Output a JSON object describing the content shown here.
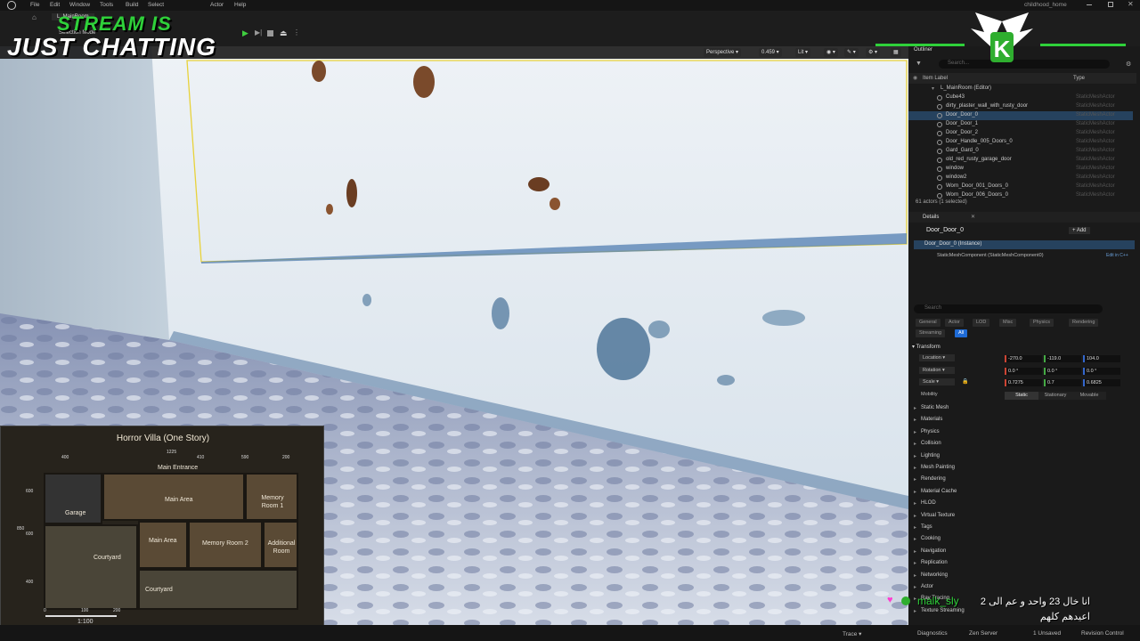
{
  "menubar": {
    "items": [
      "File",
      "Edit",
      "Window",
      "Tools",
      "Build",
      "Select",
      "Actor",
      "Help"
    ],
    "project": "childhood_home"
  },
  "toolbar": {
    "level_tab": "L_MainRoom",
    "selection_mode": "Selection Mode"
  },
  "overlay": {
    "line1": "STREAM IS",
    "line2": "JUST CHATTING"
  },
  "viewport": {
    "perspective": "Perspective",
    "fov_value": "0.459",
    "view_mode": "Lit"
  },
  "outliner": {
    "title": "Outliner",
    "search_placeholder": "Search...",
    "col_label": "Item Label",
    "col_type": "Type",
    "root": "L_MainRoom (Editor)",
    "items": [
      {
        "name": "Cube43",
        "type": "StaticMeshActor"
      },
      {
        "name": "dirty_plaster_wall_with_rusty_door",
        "type": "StaticMeshActor"
      },
      {
        "name": "Door_Door_0",
        "type": "StaticMeshActor"
      },
      {
        "name": "Door_Door_1",
        "type": "StaticMeshActor"
      },
      {
        "name": "Door_Door_2",
        "type": "StaticMeshActor"
      },
      {
        "name": "Door_Handle_005_Doors_0",
        "type": "StaticMeshActor"
      },
      {
        "name": "Gard_Gard_0",
        "type": "StaticMeshActor"
      },
      {
        "name": "old_red_rusty_garage_door",
        "type": "StaticMeshActor"
      },
      {
        "name": "window",
        "type": "StaticMeshActor"
      },
      {
        "name": "window2",
        "type": "StaticMeshActor"
      },
      {
        "name": "Worn_Door_001_Doors_0",
        "type": "StaticMeshActor"
      },
      {
        "name": "Worn_Door_006_Doors_0",
        "type": "StaticMeshActor"
      }
    ],
    "footer": "61 actors (1 selected)"
  },
  "details": {
    "title": "Details",
    "object_name": "Door_Door_0",
    "add_label": "+ Add",
    "instance": "Door_Door_0 (Instance)",
    "component": "StaticMeshComponent (StaticMeshComponent0)",
    "edit_cpp": "Edit in C++",
    "search_placeholder": "Search",
    "tabs": [
      "General",
      "Actor",
      "LOD",
      "Misc",
      "Physics",
      "Rendering",
      "Streaming",
      "All"
    ],
    "transform_label": "Transform",
    "location_label": "Location",
    "rotation_label": "Rotation",
    "scale_label": "Scale",
    "mobility_label": "Mobility",
    "location": [
      "-270.0",
      "-119.0",
      "104.0"
    ],
    "rotation": [
      "0.0 °",
      "0.0 °",
      "0.0 °"
    ],
    "scale": [
      "0.7275",
      "0.7",
      "0.6825"
    ],
    "mobility": [
      "Static",
      "Stationary",
      "Movable"
    ],
    "categories": [
      "Static Mesh",
      "Materials",
      "Physics",
      "Collision",
      "Lighting",
      "Mesh Painting",
      "Rendering",
      "Material Cache",
      "HLOD",
      "Virtual Texture",
      "Tags",
      "Cooking",
      "Navigation",
      "Replication",
      "Networking",
      "Actor",
      "Ray Tracing",
      "Texture Streaming"
    ]
  },
  "map": {
    "title": "Horror Villa (One Story)",
    "main_entrance": "Main Entrance",
    "rooms": [
      "Main Area",
      "Memory Room 1",
      "Garage",
      "Main Area",
      "Memory Room 2",
      "Additional Room",
      "Courtyard",
      "Courtyard"
    ],
    "top_dims": [
      "400",
      "1225",
      "410",
      "590",
      "200"
    ],
    "side_dims": [
      "600",
      "850",
      "600",
      "400"
    ],
    "scale_ticks": [
      "0",
      "100",
      "200"
    ],
    "scale_label": "1:100"
  },
  "chat": {
    "user": "malk_sly",
    "message": "انا خال 23 واحد و عم الى 2 اعيدهم كلهم"
  },
  "statusbar": {
    "trace": "Trace",
    "diagnostics": "Diagnostics",
    "zen": "Zen Server",
    "unsaved": "1 Unsaved",
    "revision": "Revision Control"
  },
  "colors": {
    "accent": "#2fae2f",
    "selection": "#26425e",
    "yellow_outline": "#e8d23a"
  }
}
